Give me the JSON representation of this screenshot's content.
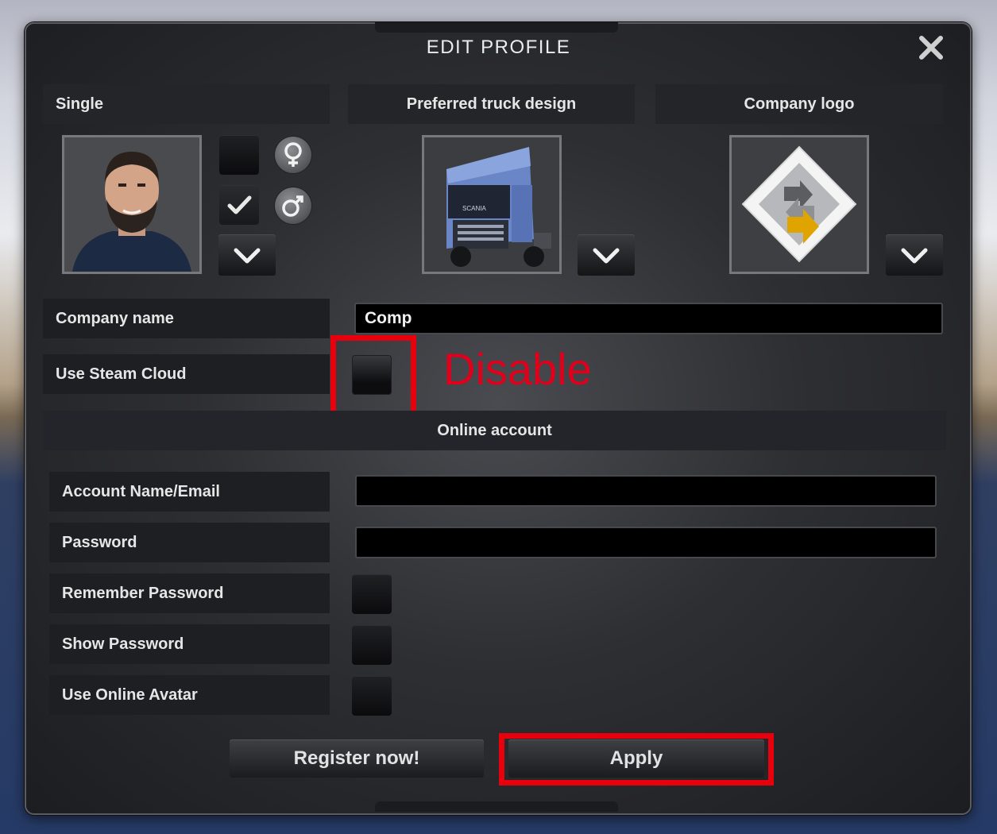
{
  "dialog": {
    "title": "EDIT PROFILE",
    "close_icon": "close-icon"
  },
  "profile": {
    "mode_label": "Single",
    "truck_label": "Preferred truck design",
    "logo_label": "Company logo",
    "female_icon": "female-symbol-icon",
    "male_icon": "male-symbol-icon",
    "dropdown_icon": "chevron-down-icon",
    "selected_gender": "male"
  },
  "company": {
    "name_label": "Company name",
    "name_value": "Comp"
  },
  "steam_cloud": {
    "label": "Use Steam Cloud",
    "checked": false
  },
  "annotation": {
    "text": "Disable",
    "color": "#e8000d"
  },
  "online": {
    "section_label": "Online account",
    "account_label": "Account Name/Email",
    "account_value": "",
    "password_label": "Password",
    "password_value": "",
    "remember_label": "Remember Password",
    "show_label": "Show Password",
    "avatar_label": "Use Online Avatar"
  },
  "buttons": {
    "register": "Register now!",
    "apply": "Apply"
  }
}
